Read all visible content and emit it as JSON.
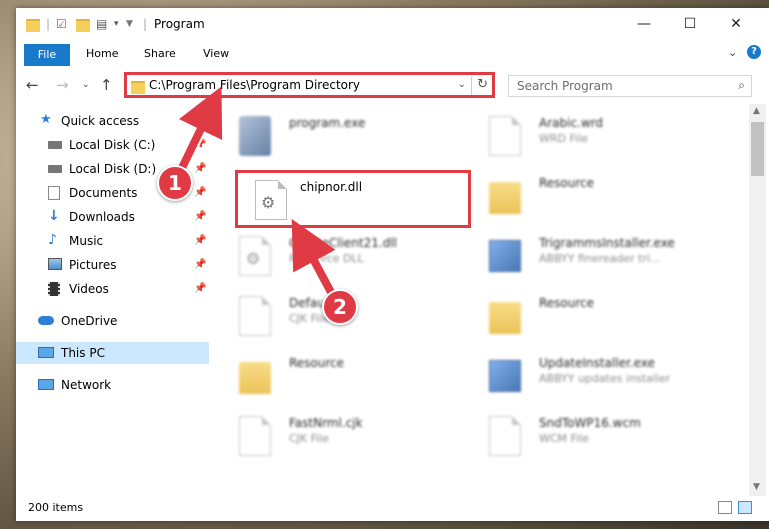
{
  "window": {
    "title": "Program"
  },
  "ribbon": {
    "tabs": [
      "File",
      "Home",
      "Share",
      "View"
    ]
  },
  "address": {
    "path": "C:\\Program Files\\Program Directory"
  },
  "search": {
    "placeholder": "Search Program"
  },
  "sidebar": {
    "items": [
      {
        "label": "Quick access",
        "icon": "star-icon",
        "pinned": false,
        "indent": 0
      },
      {
        "label": "Local Disk (C:)",
        "icon": "drive-icon",
        "pinned": true,
        "indent": 1
      },
      {
        "label": "Local Disk (D:)",
        "icon": "drive-icon",
        "pinned": true,
        "indent": 1
      },
      {
        "label": "Documents",
        "icon": "documents-icon",
        "pinned": true,
        "indent": 1
      },
      {
        "label": "Downloads",
        "icon": "download-icon",
        "pinned": true,
        "indent": 1
      },
      {
        "label": "Music",
        "icon": "music-icon",
        "pinned": true,
        "indent": 1
      },
      {
        "label": "Pictures",
        "icon": "pictures-icon",
        "pinned": true,
        "indent": 1
      },
      {
        "label": "Videos",
        "icon": "videos-icon",
        "pinned": true,
        "indent": 1
      },
      {
        "label": "OneDrive",
        "icon": "cloud-icon",
        "pinned": false,
        "indent": 0
      },
      {
        "label": "This PC",
        "icon": "computer-icon",
        "pinned": false,
        "indent": 0,
        "selected": true
      },
      {
        "label": "Network",
        "icon": "network-icon",
        "pinned": false,
        "indent": 0
      }
    ]
  },
  "files": [
    {
      "name": "program.exe",
      "type": "",
      "icon": "app-icon"
    },
    {
      "name": "Arabic.wrd",
      "type": "WRD File",
      "icon": "document-icon"
    },
    {
      "name": "chipnor.dll",
      "type": "",
      "icon": "dll-gear-icon"
    },
    {
      "name": "Resource",
      "type": "",
      "icon": "folder-icon"
    },
    {
      "name": "CreateClient21.dll",
      "type": "Resource DLL",
      "icon": "dll-gear-icon"
    },
    {
      "name": "TrigrammsInstaller.exe",
      "type": "ABBYY finereader tri...",
      "icon": "installer-icon"
    },
    {
      "name": "Default.cjk",
      "type": "CJK File",
      "icon": "document-icon"
    },
    {
      "name": "Resource",
      "type": "",
      "icon": "folder-icon"
    },
    {
      "name": "Resource",
      "type": "",
      "icon": "folder-icon"
    },
    {
      "name": "UpdateInstaller.exe",
      "type": "ABBYY updates installer",
      "icon": "installer-icon"
    },
    {
      "name": "FastNrml.cjk",
      "type": "CJK File",
      "icon": "document-icon"
    },
    {
      "name": "SndToWP16.wcm",
      "type": "WCM File",
      "icon": "document-icon"
    }
  ],
  "status": {
    "count": "200 items"
  },
  "annotations": {
    "step1": "1",
    "step2": "2"
  },
  "colors": {
    "accent": "#1979ca",
    "highlight": "#e03a45",
    "selected": "#cce8ff"
  }
}
